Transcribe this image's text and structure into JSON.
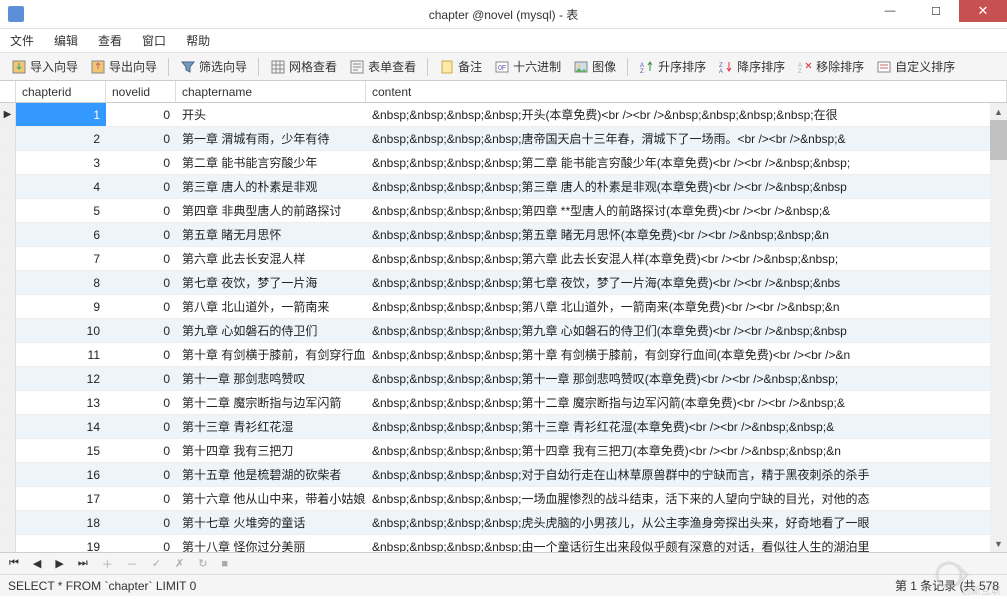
{
  "window": {
    "title": "chapter @novel (mysql) - 表"
  },
  "menu": {
    "file": "文件",
    "edit": "编辑",
    "view": "查看",
    "window": "窗口",
    "help": "帮助"
  },
  "toolbar": {
    "import": "导入向导",
    "export": "导出向导",
    "filter": "筛选向导",
    "gridview": "网格查看",
    "formview": "表单查看",
    "memo": "备注",
    "hex": "十六进制",
    "image": "图像",
    "sortasc": "升序排序",
    "sortdesc": "降序排序",
    "removesort": "移除排序",
    "customsort": "自定义排序"
  },
  "columns": {
    "chapterid": "chapterid",
    "novelid": "novelid",
    "chaptername": "chaptername",
    "content": "content"
  },
  "rows": [
    {
      "chapterid": "1",
      "novelid": "0",
      "chaptername": "开头",
      "content": "&nbsp;&nbsp;&nbsp;&nbsp;开头(本章免费)<br /><br />&nbsp;&nbsp;&nbsp;&nbsp;在很"
    },
    {
      "chapterid": "2",
      "novelid": "0",
      "chaptername": "第一章 渭城有雨，少年有待",
      "content": "&nbsp;&nbsp;&nbsp;&nbsp;唐帝国天启十三年春，渭城下了一场雨。<br /><br />&nbsp;&"
    },
    {
      "chapterid": "3",
      "novelid": "0",
      "chaptername": "第二章 能书能言穷酸少年",
      "content": "&nbsp;&nbsp;&nbsp;&nbsp;第二章 能书能言穷酸少年(本章免费)<br /><br />&nbsp;&nbsp;"
    },
    {
      "chapterid": "4",
      "novelid": "0",
      "chaptername": "第三章 唐人的朴素是非观",
      "content": "&nbsp;&nbsp;&nbsp;&nbsp;第三章 唐人的朴素是非观(本章免费)<br /><br />&nbsp;&nbsp"
    },
    {
      "chapterid": "5",
      "novelid": "0",
      "chaptername": "第四章 非典型唐人的前路探讨",
      "content": "&nbsp;&nbsp;&nbsp;&nbsp;第四章 **型唐人的前路探讨(本章免费)<br /><br />&nbsp;&"
    },
    {
      "chapterid": "6",
      "novelid": "0",
      "chaptername": "第五章 睹无月思怀",
      "content": "&nbsp;&nbsp;&nbsp;&nbsp;第五章 睹无月思怀(本章免费)<br /><br />&nbsp;&nbsp;&n"
    },
    {
      "chapterid": "7",
      "novelid": "0",
      "chaptername": "第六章 此去长安混人样",
      "content": "&nbsp;&nbsp;&nbsp;&nbsp;第六章 此去长安混人样(本章免费)<br /><br />&nbsp;&nbsp;"
    },
    {
      "chapterid": "8",
      "novelid": "0",
      "chaptername": "第七章 夜饮，梦了一片海",
      "content": "&nbsp;&nbsp;&nbsp;&nbsp;第七章 夜饮，梦了一片海(本章免费)<br /><br />&nbsp;&nbs"
    },
    {
      "chapterid": "9",
      "novelid": "0",
      "chaptername": "第八章 北山道外，一箭南来",
      "content": "&nbsp;&nbsp;&nbsp;&nbsp;第八章 北山道外，一箭南来(本章免费)<br /><br />&nbsp;&n"
    },
    {
      "chapterid": "10",
      "novelid": "0",
      "chaptername": "第九章 心如磐石的侍卫们",
      "content": "&nbsp;&nbsp;&nbsp;&nbsp;第九章 心如磐石的侍卫们(本章免费)<br /><br />&nbsp;&nbsp"
    },
    {
      "chapterid": "11",
      "novelid": "0",
      "chaptername": "第十章 有剑横于膝前，有剑穿行血",
      "content": "&nbsp;&nbsp;&nbsp;&nbsp;第十章 有剑横于膝前，有剑穿行血间(本章免费)<br /><br />&n"
    },
    {
      "chapterid": "12",
      "novelid": "0",
      "chaptername": "第十一章 那剑悲鸣赞叹",
      "content": "&nbsp;&nbsp;&nbsp;&nbsp;第十一章 那剑悲鸣赞叹(本章免费)<br /><br />&nbsp;&nbsp;"
    },
    {
      "chapterid": "13",
      "novelid": "0",
      "chaptername": "第十二章 魔宗断指与边军闪箭",
      "content": "&nbsp;&nbsp;&nbsp;&nbsp;第十二章 魔宗断指与边军闪箭(本章免费)<br /><br />&nbsp;&"
    },
    {
      "chapterid": "14",
      "novelid": "0",
      "chaptername": "第十三章 青衫红花湿",
      "content": "&nbsp;&nbsp;&nbsp;&nbsp;第十三章 青衫红花湿(本章免费)<br /><br />&nbsp;&nbsp;&"
    },
    {
      "chapterid": "15",
      "novelid": "0",
      "chaptername": "第十四章 我有三把刀",
      "content": "&nbsp;&nbsp;&nbsp;&nbsp;第十四章 我有三把刀(本章免费)<br /><br />&nbsp;&nbsp;&n"
    },
    {
      "chapterid": "16",
      "novelid": "0",
      "chaptername": "第十五章 他是梳碧湖的砍柴者",
      "content": "&nbsp;&nbsp;&nbsp;&nbsp;对于自幼行走在山林草原兽群中的宁缺而言，精于黑夜刺杀的杀手"
    },
    {
      "chapterid": "17",
      "novelid": "0",
      "chaptername": "第十六章 他从山中来，带着小姑娘",
      "content": "&nbsp;&nbsp;&nbsp;&nbsp;一场血腥惨烈的战斗结束，活下来的人望向宁缺的目光，对他的态"
    },
    {
      "chapterid": "18",
      "novelid": "0",
      "chaptername": "第十七章 火堆旁的童话",
      "content": "&nbsp;&nbsp;&nbsp;&nbsp;虎头虎脑的小男孩儿，从公主李渔身旁探出头来，好奇地看了一眼"
    },
    {
      "chapterid": "19",
      "novelid": "0",
      "chaptername": "第十八章 怪你过分美丽",
      "content": "&nbsp;&nbsp;&nbsp;&nbsp;由一个童话衍生出来段似乎颇有深意的对话，看似往人生的湖泊里"
    }
  ],
  "statusbar": {
    "sql": "SELECT * FROM `chapter` LIMIT 0",
    "recordinfo": "第 1 条记录 (共 578"
  },
  "watermark": "创新互联"
}
